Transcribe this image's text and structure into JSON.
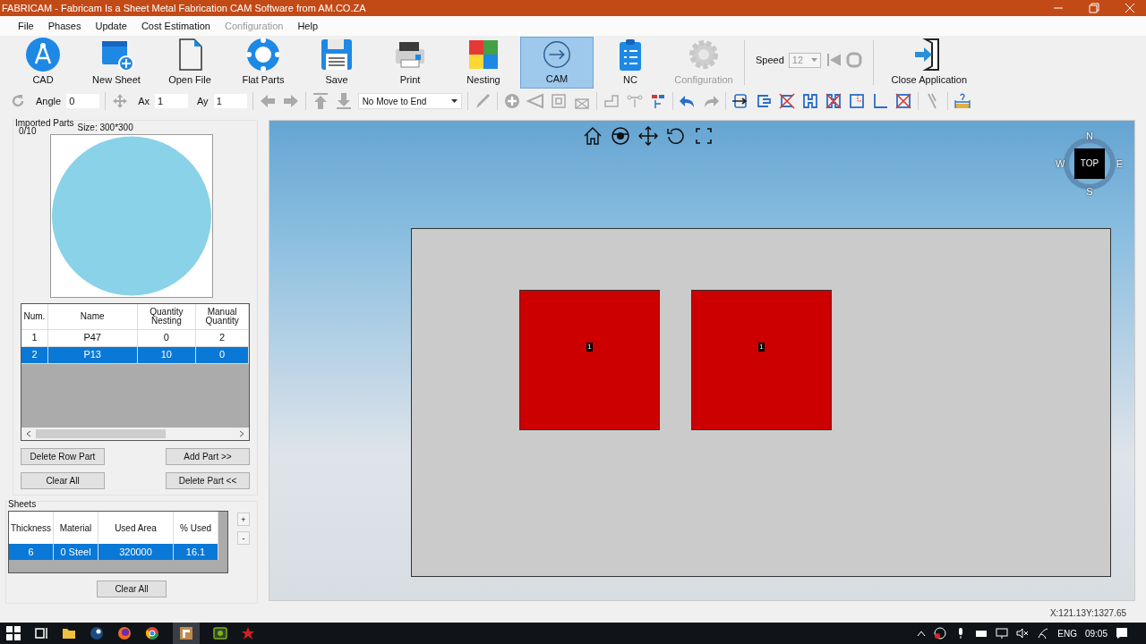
{
  "window": {
    "title": "FABRICAM - Fabricam Is a Sheet Metal Fabrication CAM Software from AM.CO.ZA"
  },
  "menu": [
    {
      "label": "File",
      "disabled": false
    },
    {
      "label": "Phases",
      "disabled": false
    },
    {
      "label": "Update",
      "disabled": false
    },
    {
      "label": "Cost Estimation",
      "disabled": false
    },
    {
      "label": "Configuration",
      "disabled": true
    },
    {
      "label": "Help",
      "disabled": false
    }
  ],
  "toolbar": [
    {
      "kind": "cad",
      "label": "CAD",
      "selected": false,
      "disabled": false
    },
    {
      "kind": "new-sheet",
      "label": "New Sheet",
      "selected": false,
      "disabled": false
    },
    {
      "kind": "open-file",
      "label": "Open File",
      "selected": false,
      "disabled": false
    },
    {
      "kind": "flat-parts",
      "label": "Flat Parts",
      "selected": false,
      "disabled": false
    },
    {
      "kind": "save",
      "label": "Save",
      "selected": false,
      "disabled": false
    },
    {
      "kind": "print",
      "label": "Print",
      "selected": false,
      "disabled": false
    },
    {
      "kind": "nesting",
      "label": "Nesting",
      "selected": false,
      "disabled": false
    },
    {
      "kind": "cam",
      "label": "CAM",
      "selected": true,
      "disabled": false
    },
    {
      "kind": "nc",
      "label": "NC",
      "selected": false,
      "disabled": false
    },
    {
      "kind": "configuration",
      "label": "Configuration",
      "selected": false,
      "disabled": true
    }
  ],
  "speed": {
    "label": "Speed",
    "value": "12",
    "disabled": true
  },
  "close_button": {
    "label": "Close Application"
  },
  "tool_row": [
    {
      "kind": "icon",
      "disabled": true
    },
    {
      "kind": "field",
      "label": "Angle",
      "value": "0"
    },
    {
      "kind": "sep"
    },
    {
      "kind": "icon",
      "disabled": true
    },
    {
      "kind": "field",
      "label": "Ax",
      "value": "1"
    },
    {
      "kind": "field",
      "label": "Ay",
      "value": "1"
    },
    {
      "kind": "sep"
    },
    {
      "kind": "icon",
      "disabled": true
    },
    {
      "kind": "icon",
      "disabled": true
    },
    {
      "kind": "sep"
    },
    {
      "kind": "icon",
      "disabled": true
    },
    {
      "kind": "icon",
      "disabled": true
    },
    {
      "kind": "dropdown",
      "value": "No Move to End"
    },
    {
      "kind": "sep"
    },
    {
      "kind": "icon",
      "disabled": true
    },
    {
      "kind": "sep"
    },
    {
      "kind": "icon",
      "disabled": true
    },
    {
      "kind": "icon",
      "disabled": true
    },
    {
      "kind": "icon",
      "disabled": true
    },
    {
      "kind": "icon",
      "disabled": true
    },
    {
      "kind": "sep"
    },
    {
      "kind": "icon",
      "disabled": true
    },
    {
      "kind": "icon",
      "disabled": true
    },
    {
      "kind": "icon",
      "disabled": false
    },
    {
      "kind": "sep"
    },
    {
      "kind": "icon",
      "disabled": false
    },
    {
      "kind": "icon",
      "disabled": true
    },
    {
      "kind": "sep"
    },
    {
      "kind": "icon",
      "disabled": false
    },
    {
      "kind": "icon",
      "disabled": false
    },
    {
      "kind": "icon",
      "disabled": false
    },
    {
      "kind": "icon",
      "disabled": false
    },
    {
      "kind": "icon",
      "disabled": false
    },
    {
      "kind": "icon",
      "disabled": false
    },
    {
      "kind": "icon",
      "disabled": false
    },
    {
      "kind": "icon",
      "disabled": false
    },
    {
      "kind": "sep"
    },
    {
      "kind": "icon",
      "disabled": true
    },
    {
      "kind": "sep"
    },
    {
      "kind": "icon",
      "disabled": false
    }
  ],
  "imported_parts": {
    "title": "Imported Parts",
    "count": "0/10",
    "size": "Size: 300*300",
    "columns": [
      "Num.",
      "Name",
      "Quantity Nesting",
      "Manual Quantity"
    ],
    "rows": [
      {
        "cells": [
          "1",
          "P47",
          "0",
          "2"
        ],
        "selected": false
      },
      {
        "cells": [
          "2",
          "P13",
          "10",
          "0"
        ],
        "selected": true
      }
    ],
    "buttons": [
      "Delete Row Part",
      "Add Part >>",
      "Clear All",
      "Delete Part <<"
    ]
  },
  "sheets": {
    "title": "Sheets",
    "columns": [
      "Thickness",
      "Material",
      "Used Area",
      "% Used"
    ],
    "rows": [
      {
        "cells": [
          "6",
          "0  Steel",
          "320000",
          "16.1"
        ],
        "selected": true
      }
    ],
    "side_buttons": [
      "+",
      "-"
    ],
    "clear_button": "Clear All"
  },
  "viewport": {
    "compass": {
      "north": "N",
      "south": "S",
      "east": "E",
      "west": "W",
      "face": "TOP"
    },
    "parts": [
      {
        "label": "1",
        "color": "#cc0000"
      },
      {
        "label": "1",
        "color": "#cc0000"
      }
    ]
  },
  "status": {
    "coordinates": "X:121.13Y:1327.65"
  },
  "taskbar": {
    "language": "ENG",
    "time": "09:05"
  }
}
